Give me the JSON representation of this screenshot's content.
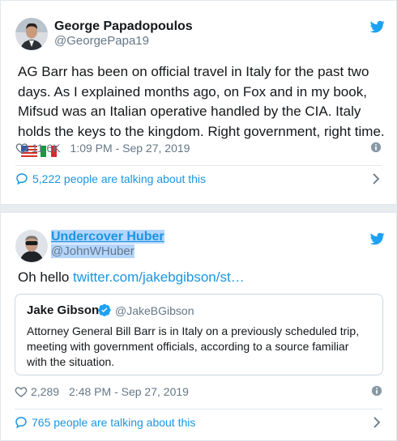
{
  "tweets": [
    {
      "name": "George Papadopoulos",
      "handle": "@GeorgePapa19",
      "text": "AG Barr has been on official travel in Italy for the past two days. As I explained months ago, on Fox and in my book, Mifsud was an Italian operative handled by the CIA. Italy holds the keys to the kingdom. Right government, right time.",
      "likes": "11.6K",
      "timestamp": "1:09 PM - Sep 27, 2019",
      "talking": "5,222 people are talking about this"
    },
    {
      "name": "Undercover Huber",
      "handle": "@JohnWHuber",
      "text": "Oh hello ",
      "link": "twitter.com/jakebgibson/st…",
      "quote": {
        "name": "Jake Gibson",
        "handle": "@JakeBGibson",
        "text": "Attorney General Bill Barr is in Italy on a previously scheduled trip, meeting with government officials, according to a source familiar with the situation."
      },
      "likes": "2,289",
      "timestamp": "2:48 PM - Sep 27, 2019",
      "talking": "765 people are talking about this"
    }
  ],
  "icons": {
    "brand": "twitter-bird-icon",
    "like": "heart-icon",
    "info": "info-icon",
    "talk": "speech-bubble-icon",
    "more": "chevron-right-icon",
    "verified": "verified-badge-icon",
    "flags": [
      "us-flag-icon",
      "italy-flag-icon"
    ]
  },
  "colors": {
    "link": "#1b95e0",
    "text": "#14171a",
    "muted": "#657786",
    "border": "#e1e8ed",
    "selection": "#b4d5fe"
  }
}
